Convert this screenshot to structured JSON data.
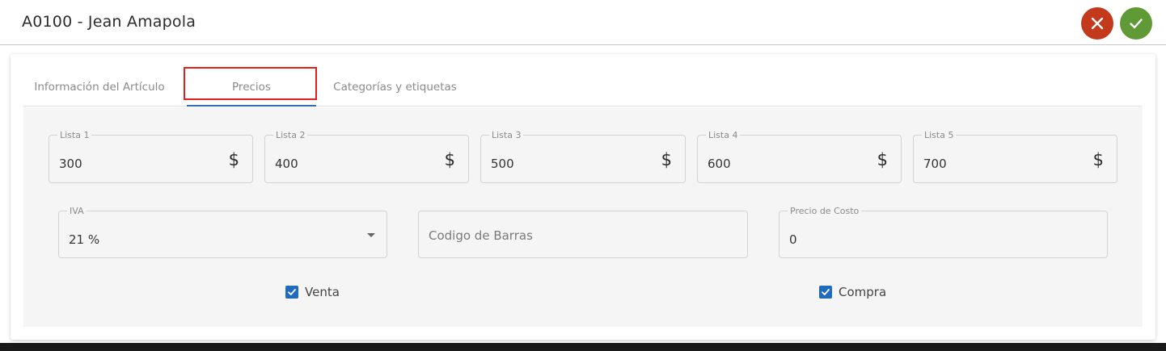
{
  "header": {
    "title": "A0100 - Jean Amapola"
  },
  "tabs": [
    {
      "label": "Información del Artículo"
    },
    {
      "label": "Precios"
    },
    {
      "label": "Categorías y etiquetas"
    }
  ],
  "prices": [
    {
      "label": "Lista 1",
      "value": "300",
      "icon": "$"
    },
    {
      "label": "Lista 2",
      "value": "400",
      "icon": "$"
    },
    {
      "label": "Lista 3",
      "value": "500",
      "icon": "$"
    },
    {
      "label": "Lista 4",
      "value": "600",
      "icon": "$"
    },
    {
      "label": "Lista 5",
      "value": "700",
      "icon": "$"
    }
  ],
  "iva": {
    "label": "IVA",
    "value": "21 %"
  },
  "barcode": {
    "placeholder": "Codigo de Barras"
  },
  "cost": {
    "label": "Precio de Costo",
    "value": "0"
  },
  "checks": {
    "venta": {
      "label": "Venta",
      "checked": true
    },
    "compra": {
      "label": "Compra",
      "checked": true
    }
  },
  "colors": {
    "cancel": "#c23a1b",
    "confirm": "#5f9a36",
    "accent": "#2e6fb5",
    "highlight": "#e0201d"
  }
}
